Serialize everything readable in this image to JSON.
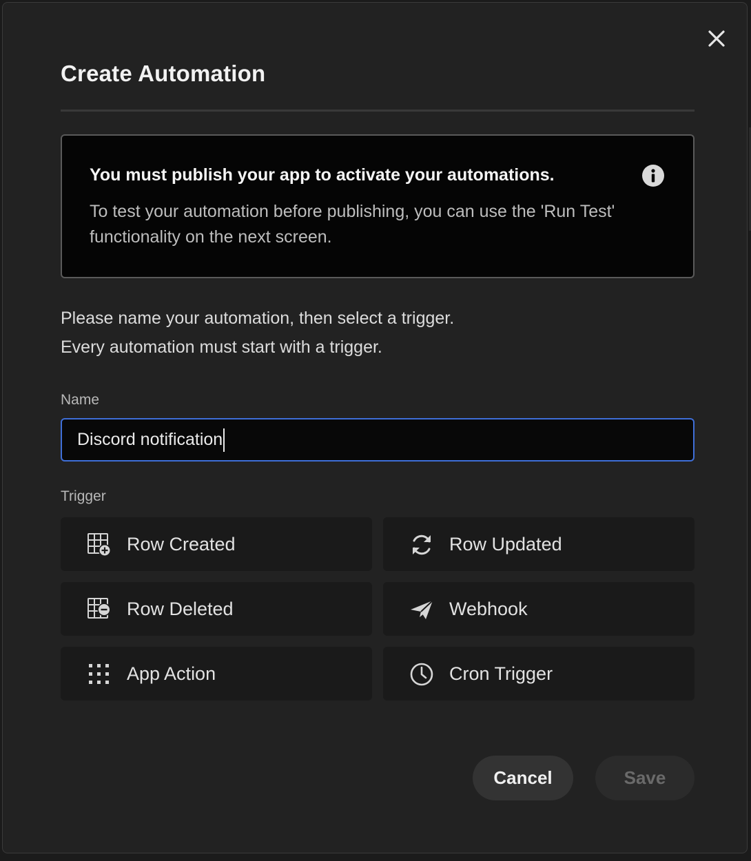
{
  "dialog": {
    "title": "Create Automation",
    "close_icon": "close-icon"
  },
  "notice": {
    "title": "You must publish your app to activate your automations.",
    "body_line1": "To test your automation before publishing, you can use the 'Run Test'",
    "body_line2": "functionality on the next screen.",
    "icon": "info-icon"
  },
  "intro": {
    "line1": "Please name your automation, then select a trigger.",
    "line2": "Every automation must start with a trigger."
  },
  "name_field": {
    "label": "Name",
    "value": "Discord notification"
  },
  "trigger_section": {
    "label": "Trigger",
    "options": [
      {
        "label": "Row Created",
        "icon": "row-created-icon"
      },
      {
        "label": "Row Updated",
        "icon": "refresh-icon"
      },
      {
        "label": "Row Deleted",
        "icon": "row-deleted-icon"
      },
      {
        "label": "Webhook",
        "icon": "send-icon"
      },
      {
        "label": "App Action",
        "icon": "grid-dots-icon"
      },
      {
        "label": "Cron Trigger",
        "icon": "clock-icon"
      }
    ]
  },
  "actions": {
    "cancel_label": "Cancel",
    "save_label": "Save"
  },
  "colors": {
    "modal_bg": "#222222",
    "notice_bg": "#050505",
    "focus_border": "#3f6fd8",
    "text_primary": "#f2f2f2",
    "save_disabled_text": "#6a6a6a"
  }
}
